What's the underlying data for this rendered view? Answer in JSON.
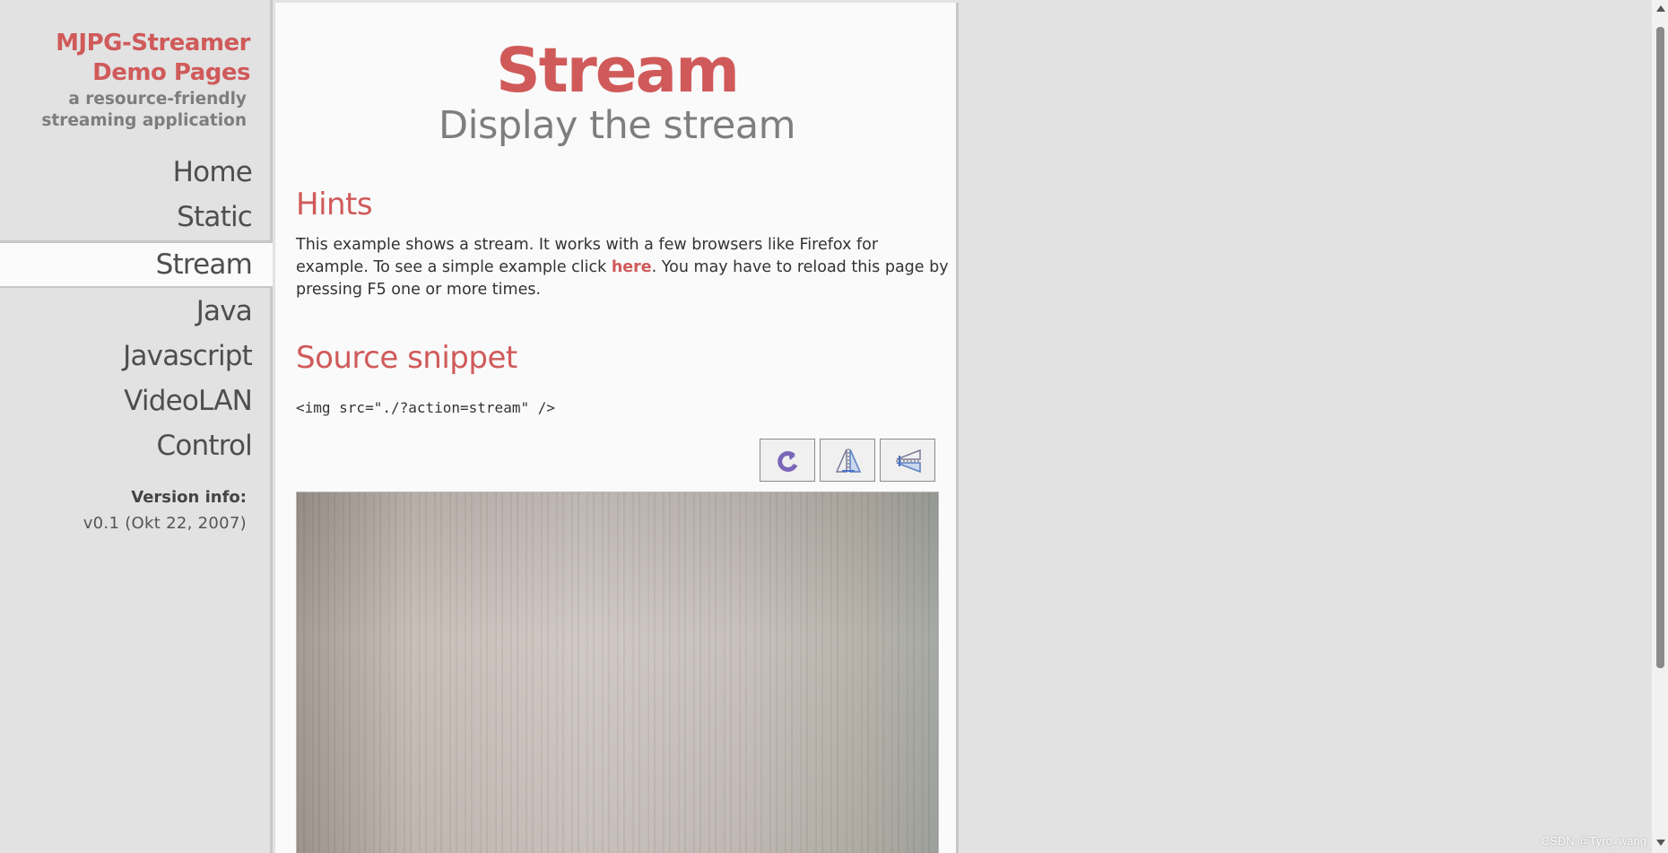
{
  "sidebar": {
    "brand_line1": "MJPG-Streamer",
    "brand_line2": "Demo Pages",
    "tagline_line1": "a resource-friendly",
    "tagline_line2": "streaming application",
    "nav": [
      {
        "label": "Home"
      },
      {
        "label": "Static"
      },
      {
        "label": "Stream",
        "active": true
      },
      {
        "label": "Java"
      },
      {
        "label": "Javascript"
      },
      {
        "label": "VideoLAN"
      },
      {
        "label": "Control"
      }
    ],
    "version_label": "Version info:",
    "version_value": "v0.1 (Okt 22, 2007)"
  },
  "main": {
    "title": "Stream",
    "subtitle": "Display the stream",
    "hints_heading": "Hints",
    "hints_text_1": "This example shows a stream. It works with a few browsers like Firefox for example. To see a simple example click ",
    "hints_link": "here",
    "hints_text_2": ". You may have to reload this page by pressing F5 one or more times.",
    "source_heading": "Source snippet",
    "code": "<img src=\"./?action=stream\" />",
    "toolbar_icons": [
      "rotate-icon",
      "flip-vertical-icon",
      "flip-horizontal-icon"
    ]
  },
  "watermark": "CSDN @Tyro_wang",
  "colors": {
    "accent": "#d05a5a",
    "sidebar_bg": "#e2e2e2",
    "content_bg": "#fafafa"
  }
}
